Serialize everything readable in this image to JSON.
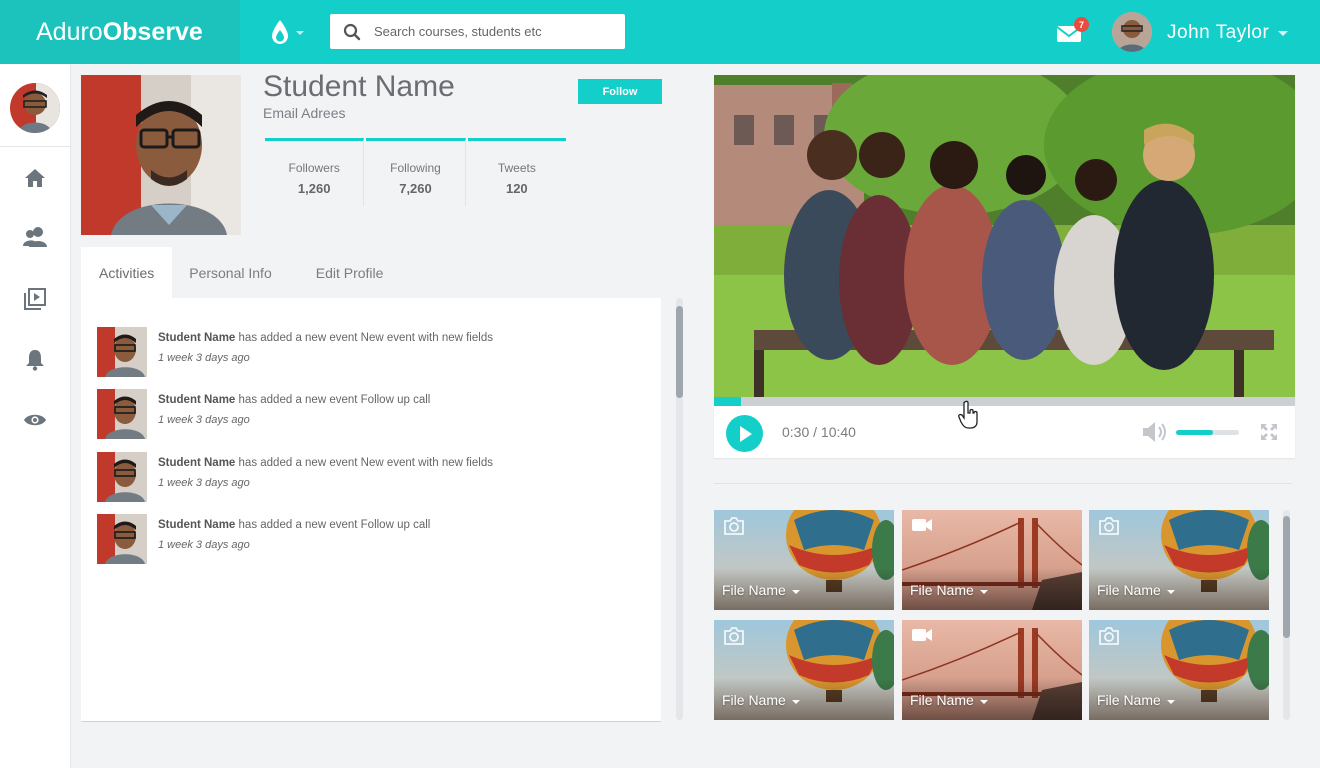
{
  "header": {
    "brand_light": "Aduro",
    "brand_bold": "Observe",
    "search_placeholder": "Search courses, students etc",
    "notifications_count": "7",
    "user_name": "John Taylor"
  },
  "sidebar": {
    "items": [
      {
        "name": "home"
      },
      {
        "name": "users"
      },
      {
        "name": "media"
      },
      {
        "name": "notifications"
      },
      {
        "name": "observe"
      }
    ]
  },
  "profile": {
    "name": "Student Name",
    "email": "Email Adrees",
    "follow_label": "Follow",
    "stats": [
      {
        "label": "Followers",
        "value": "1,260"
      },
      {
        "label": "Following",
        "value": "7,260"
      },
      {
        "label": "Tweets",
        "value": "120"
      }
    ]
  },
  "tabs": [
    {
      "label": "Activities",
      "active": true
    },
    {
      "label": "Personal Info",
      "active": false
    },
    {
      "label": "Edit Profile",
      "active": false
    }
  ],
  "activities": [
    {
      "actor": "Student Name",
      "text": "has added a new event New event with new fields",
      "time": "1 week 3 days ago"
    },
    {
      "actor": "Student Name",
      "text": "has added a new event Follow up call",
      "time": "1 week 3 days ago"
    },
    {
      "actor": "Student Name",
      "text": "has added a new event New event with new fields",
      "time": "1 week 3 days ago"
    },
    {
      "actor": "Student Name",
      "text": "has added a new event Follow up call",
      "time": "1 week 3 days ago"
    }
  ],
  "video": {
    "time_display": "0:30 / 10:40",
    "progress_fraction": 0.047,
    "volume_fraction": 0.58
  },
  "gallery": [
    {
      "name": "File Name",
      "kind": "photo",
      "image": "balloon"
    },
    {
      "name": "File Name",
      "kind": "video",
      "image": "bridge"
    },
    {
      "name": "File Name",
      "kind": "photo",
      "image": "balloon"
    },
    {
      "name": "File Name",
      "kind": "photo",
      "image": "balloon"
    },
    {
      "name": "File Name",
      "kind": "video",
      "image": "bridge"
    },
    {
      "name": "File Name",
      "kind": "photo",
      "image": "balloon"
    }
  ],
  "colors": {
    "accent": "#14cfc9",
    "brand_bg": "#1cc3bd",
    "badge": "#e74c3c"
  }
}
